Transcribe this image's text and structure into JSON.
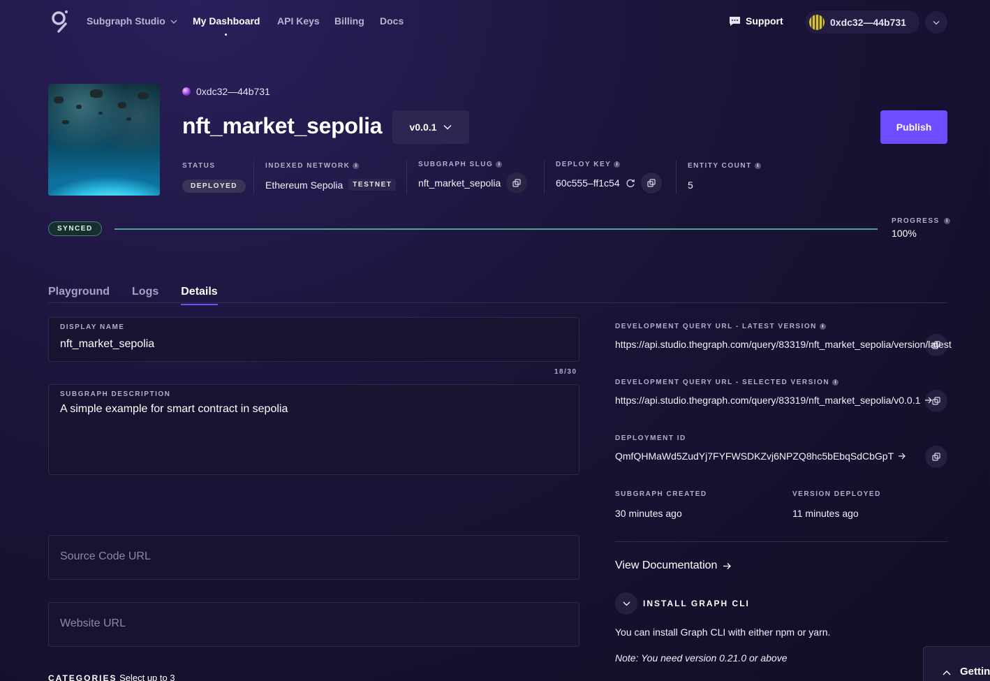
{
  "nav": {
    "studio_label": "Subgraph Studio",
    "dashboard_label": "My Dashboard",
    "api_keys_label": "API Keys",
    "billing_label": "Billing",
    "docs_label": "Docs",
    "support_label": "Support",
    "account_label": "0xdc32—44b731"
  },
  "header": {
    "owner": "0xdc32—44b731",
    "title": "nft_market_sepolia",
    "version": "v0.0.1",
    "publish_label": "Publish"
  },
  "meta": {
    "status_label": "STATUS",
    "status_value": "DEPLOYED",
    "network_label": "INDEXED NETWORK",
    "network_value": "Ethereum Sepolia",
    "network_tag": "TESTNET",
    "slug_label": "SUBGRAPH SLUG",
    "slug_value": "nft_market_sepolia",
    "deploy_key_label": "DEPLOY KEY",
    "deploy_key_value": "60c555–ff1c54",
    "entity_count_label": "ENTITY COUNT",
    "entity_count_value": "5"
  },
  "sync": {
    "status": "SYNCED",
    "progress_label": "PROGRESS",
    "progress_value": "100%",
    "progress_fraction": 1.0
  },
  "tabs": [
    "Playground",
    "Logs",
    "Details"
  ],
  "form": {
    "display_name_label": "DISPLAY NAME",
    "display_name_value": "nft_market_sepolia",
    "counter": "18/30",
    "description_label": "SUBGRAPH DESCRIPTION",
    "description_value": "A simple example for smart contract in sepolia",
    "source_code_placeholder": "Source Code URL",
    "website_placeholder": "Website URL",
    "categories_label": "CATEGORIES",
    "categories_hint": "Select up to 3"
  },
  "details": {
    "latest_url_label": "DEVELOPMENT QUERY URL - LATEST VERSION",
    "latest_url_value": "https://api.studio.thegraph.com/query/83319/nft_market_sepolia/version/latest",
    "selected_url_label": "DEVELOPMENT QUERY URL - SELECTED VERSION",
    "selected_url_value": "https://api.studio.thegraph.com/query/83319/nft_market_sepolia/v0.0.1",
    "deployment_id_label": "DEPLOYMENT ID",
    "deployment_id_value": "QmfQHMaWd5ZudYj7FYFWSDKZvj6NPZQ8hc5bEbqSdCbGpT",
    "created_label": "SUBGRAPH CREATED",
    "created_value": "30 minutes ago",
    "deployed_label": "VERSION DEPLOYED",
    "deployed_value": "11 minutes ago",
    "view_docs_label": "View Documentation",
    "install_title": "INSTALL GRAPH CLI",
    "install_text": "You can install Graph CLI with either npm or yarn.",
    "install_note": "Note: You need version 0.21.0 or above",
    "getting_started_label": "Getting"
  },
  "colors": {
    "accent": "#6f4cff",
    "synced": "#4aa596",
    "background": "#1a1438"
  }
}
